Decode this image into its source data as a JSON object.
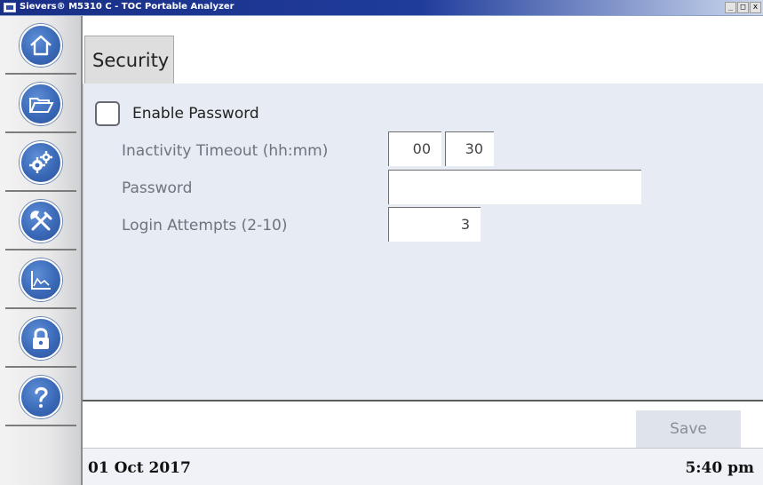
{
  "window": {
    "title": "Sievers® M5310 C - TOC Portable Analyzer",
    "controls": {
      "minimize": "_",
      "maximize": "□",
      "close": "x"
    }
  },
  "sidebar": {
    "items": [
      {
        "name": "home",
        "icon": "home-icon"
      },
      {
        "name": "files",
        "icon": "folder-icon"
      },
      {
        "name": "settings",
        "icon": "gears-icon"
      },
      {
        "name": "tools",
        "icon": "tools-icon"
      },
      {
        "name": "data",
        "icon": "chart-icon"
      },
      {
        "name": "security",
        "icon": "lock-icon"
      },
      {
        "name": "help",
        "icon": "help-icon"
      }
    ]
  },
  "tabs": [
    {
      "label": "Security",
      "active": true
    }
  ],
  "security": {
    "enable_password_label": "Enable Password",
    "enable_password_checked": false,
    "inactivity_label": "Inactivity Timeout (hh:mm)",
    "inactivity_hours": "00",
    "inactivity_minutes": "30",
    "password_label": "Password",
    "password_value": "",
    "login_attempts_label": "Login Attempts (2-10)",
    "login_attempts_value": "3"
  },
  "actions": {
    "save_label": "Save",
    "save_enabled": false
  },
  "status": {
    "date": "01 Oct 2017",
    "time": "5:40 pm"
  },
  "colors": {
    "accent_blue": "#3a69b8",
    "content_bg": "#e7ebf3",
    "titlebar": "#1f3c9b"
  }
}
